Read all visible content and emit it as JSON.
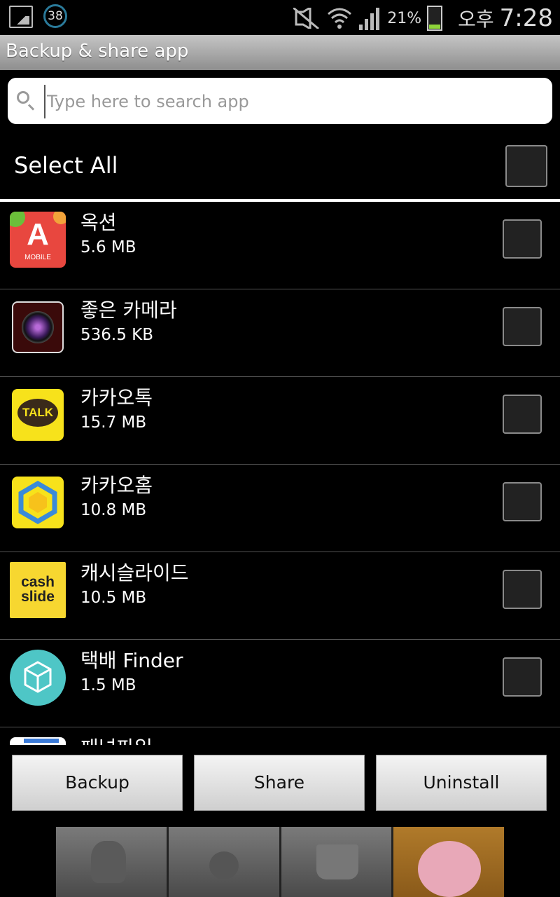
{
  "status_bar": {
    "notification_count": "38",
    "battery_percent": "21%",
    "ampm": "오후",
    "time": "7:28"
  },
  "title": "Backup & share app",
  "search": {
    "placeholder": "Type here to search app"
  },
  "select_all": {
    "label": "Select All",
    "checked": false
  },
  "apps": [
    {
      "name": "옥션",
      "size": "5.6 MB",
      "icon": "auction-icon",
      "checked": false
    },
    {
      "name": "좋은 카메라",
      "size": "536.5 KB",
      "icon": "camera-lens-icon",
      "checked": false
    },
    {
      "name": "카카오톡",
      "size": "15.7 MB",
      "icon": "kakaotalk-icon",
      "checked": false
    },
    {
      "name": "카카오홈",
      "size": "10.8 MB",
      "icon": "kakaohome-icon",
      "checked": false
    },
    {
      "name": "캐시슬라이드",
      "size": "10.5 MB",
      "icon": "cashslide-icon",
      "checked": false
    },
    {
      "name": "택배 Finder",
      "size": "1.5 MB",
      "icon": "parcel-box-icon",
      "checked": false
    },
    {
      "name": "패널파일",
      "size": "",
      "icon": "partial-app-icon",
      "checked": false
    }
  ],
  "icon_text": {
    "auction_letter": "A",
    "auction_sub": "MOBILE",
    "kakaotalk": "TALK",
    "cashslide_1": "cash",
    "cashslide_2": "slide"
  },
  "buttons": {
    "backup": "Backup",
    "share": "Share",
    "uninstall": "Uninstall"
  },
  "colors": {
    "titlebar": "#a8a8a8",
    "background": "#000000",
    "battery_fill": "#8ed43a"
  }
}
